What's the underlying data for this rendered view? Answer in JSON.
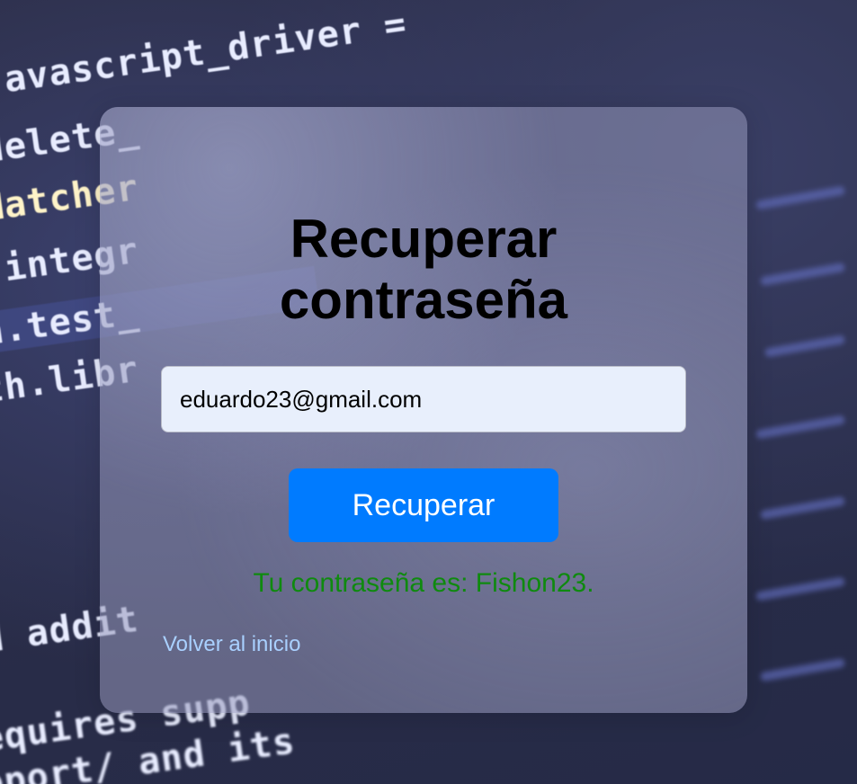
{
  "page": {
    "title_line_1": "Recuperar",
    "title_line_2": "contraseña"
  },
  "form": {
    "email_value": "eduardo23@gmail.com",
    "submit_label": "Recuperar",
    "result_message": "Tu contraseña es: Fishon23.",
    "back_link_label": "Volver al inicio"
  },
  "colors": {
    "button_bg": "#007bff",
    "success_text": "#0f8a0f",
    "link_text": "#a9d0ff",
    "input_bg": "#e8effc"
  }
}
